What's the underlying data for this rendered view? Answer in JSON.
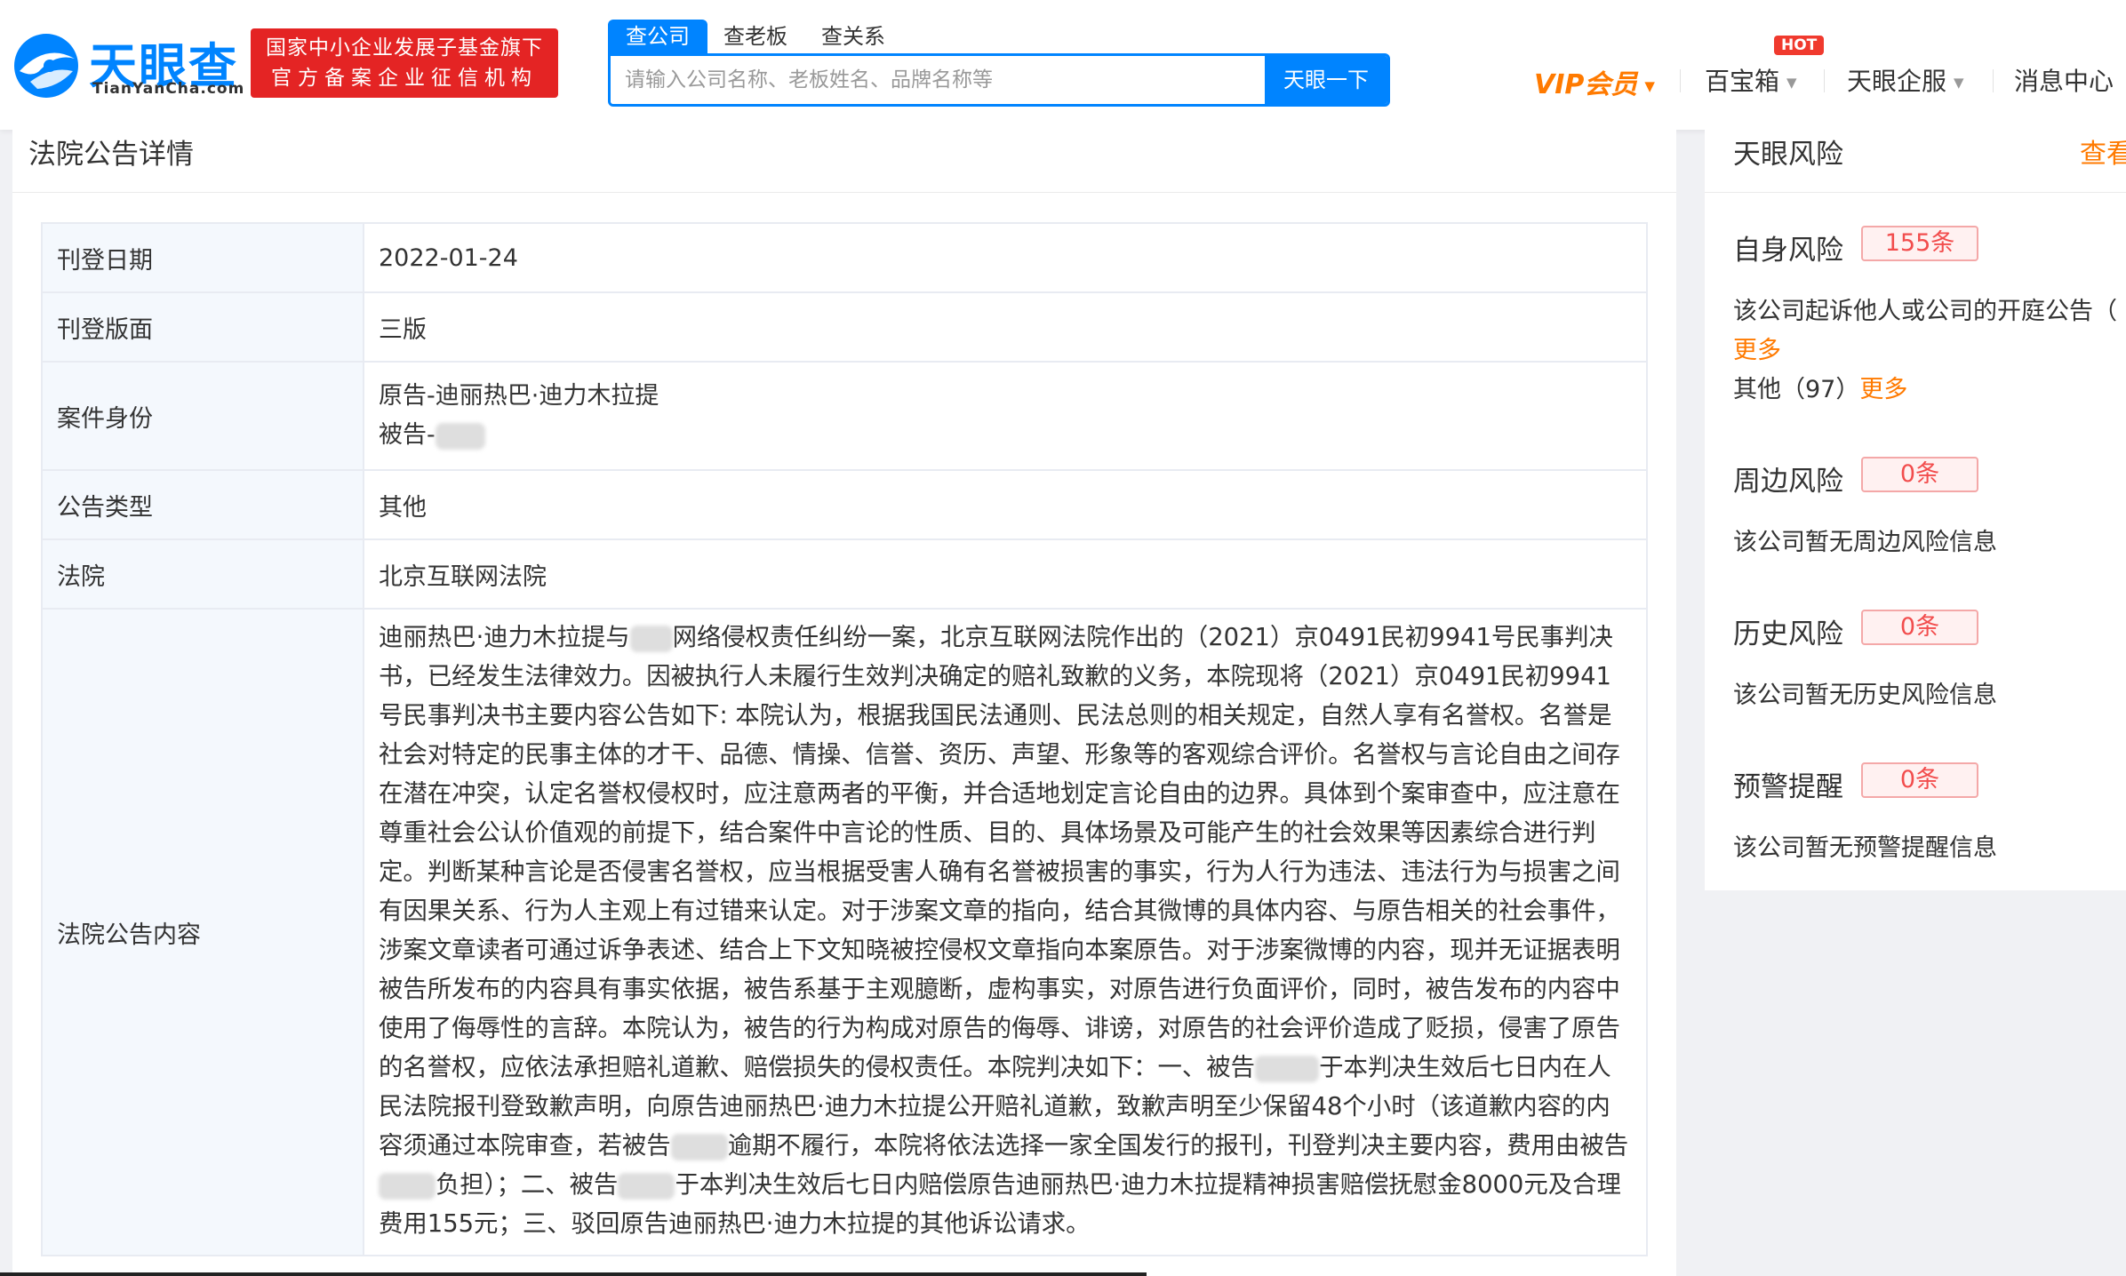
{
  "header": {
    "logo_cn": "天眼查",
    "logo_en": "TianYanCha.com",
    "badge_line1": "国家中小企业发展子基金旗下",
    "badge_line2": "官方备案企业征信机构",
    "search_tabs": [
      "查公司",
      "查老板",
      "查关系"
    ],
    "search_placeholder": "请输入公司名称、老板姓名、品牌名称等",
    "search_button": "天眼一下",
    "nav": {
      "vip": "VIP会员",
      "baibao": "百宝箱",
      "hot": "HOT",
      "qifu": "天眼企服",
      "messages": "消息中心"
    }
  },
  "main": {
    "title": "法院公告详情",
    "rows": {
      "date": {
        "label": "刊登日期",
        "value": "2022-01-24"
      },
      "edition": {
        "label": "刊登版面",
        "value": "三版"
      },
      "case": {
        "label": "案件身份",
        "plaintiff": "原告-迪丽热巴·迪力木拉提",
        "defendant": "被告-"
      },
      "type": {
        "label": "公告类型",
        "value": "其他"
      },
      "court": {
        "label": "法院",
        "value": "北京互联网法院"
      },
      "content": {
        "label": "法院公告内容",
        "p1": "迪丽热巴·迪力木拉提与",
        "p2": "网络侵权责任纠纷一案，北京互联网法院作出的（2021）京0491民初9941号民事判决书，已经发生法律效力。因被执行人未履行生效判决确定的赔礼致歉的义务，本院现将（2021）京0491民初9941号民事判决书主要内容公告如下: 本院认为，根据我国民法通则、民法总则的相关规定，自然人享有名誉权。名誉是社会对特定的民事主体的才干、品德、情操、信誉、资历、声望、形象等的客观综合评价。名誉权与言论自由之间存在潜在冲突，认定名誉权侵权时，应注意两者的平衡，并合适地划定言论自由的边界。具体到个案审查中，应注意在尊重社会公认价值观的前提下，结合案件中言论的性质、目的、具体场景及可能产生的社会效果等因素综合进行判定。判断某种言论是否侵害名誉权，应当根据受害人确有名誉被损害的事实，行为人行为违法、违法行为与损害之间有因果关系、行为人主观上有过错来认定。对于涉案文章的指向，结合其微博的具体内容、与原告相关的社会事件，涉案文章读者可通过诉争表述、结合上下文知晓被控侵权文章指向本案原告。对于涉案微博的内容，现并无证据表明被告所发布的内容具有事实依据，被告系基于主观臆断，虚构事实，对原告进行负面评价，同时，被告发布的内容中使用了侮辱性的言辞。本院认为，被告的行为构成对原告的侮辱、诽谤，对原告的社会评价造成了贬损，侵害了原告的名誉权，应依法承担赔礼道歉、赔偿损失的侵权责任。本院判决如下：一、被告",
        "p3": "于本判决生效后七日内在人民法院报刊登致歉声明，向原告迪丽热巴·迪力木拉提公开赔礼道歉，致歉声明至少保留48个小时（该道歉内容的内容须通过本院审查，若被告",
        "p4": "逾期不履行，本院将依法选择一家全国发行的报刊，刊登判决主要内容，费用由被告",
        "p5": "负担）；二、被告",
        "p6": "于本判决生效后七日内赔偿原告迪丽热巴·迪力木拉提精神损害赔偿抚慰金8000元及合理费用155元；三、驳回原告迪丽热巴·迪力木拉提的其他诉讼请求。"
      }
    }
  },
  "side": {
    "title": "天眼风险",
    "view_link": "查看",
    "self_risk": {
      "label": "自身风险",
      "count": "155条",
      "line1": "该公司起诉他人或公司的开庭公告（",
      "more1": "更多",
      "line2": "其他（97）",
      "more2": "更多"
    },
    "around_risk": {
      "label": "周边风险",
      "count": "0条",
      "text": "该公司暂无周边风险信息"
    },
    "history_risk": {
      "label": "历史风险",
      "count": "0条",
      "text": "该公司暂无历史风险信息"
    },
    "warning": {
      "label": "预警提醒",
      "count": "0条",
      "text": "该公司暂无预警提醒信息"
    }
  }
}
